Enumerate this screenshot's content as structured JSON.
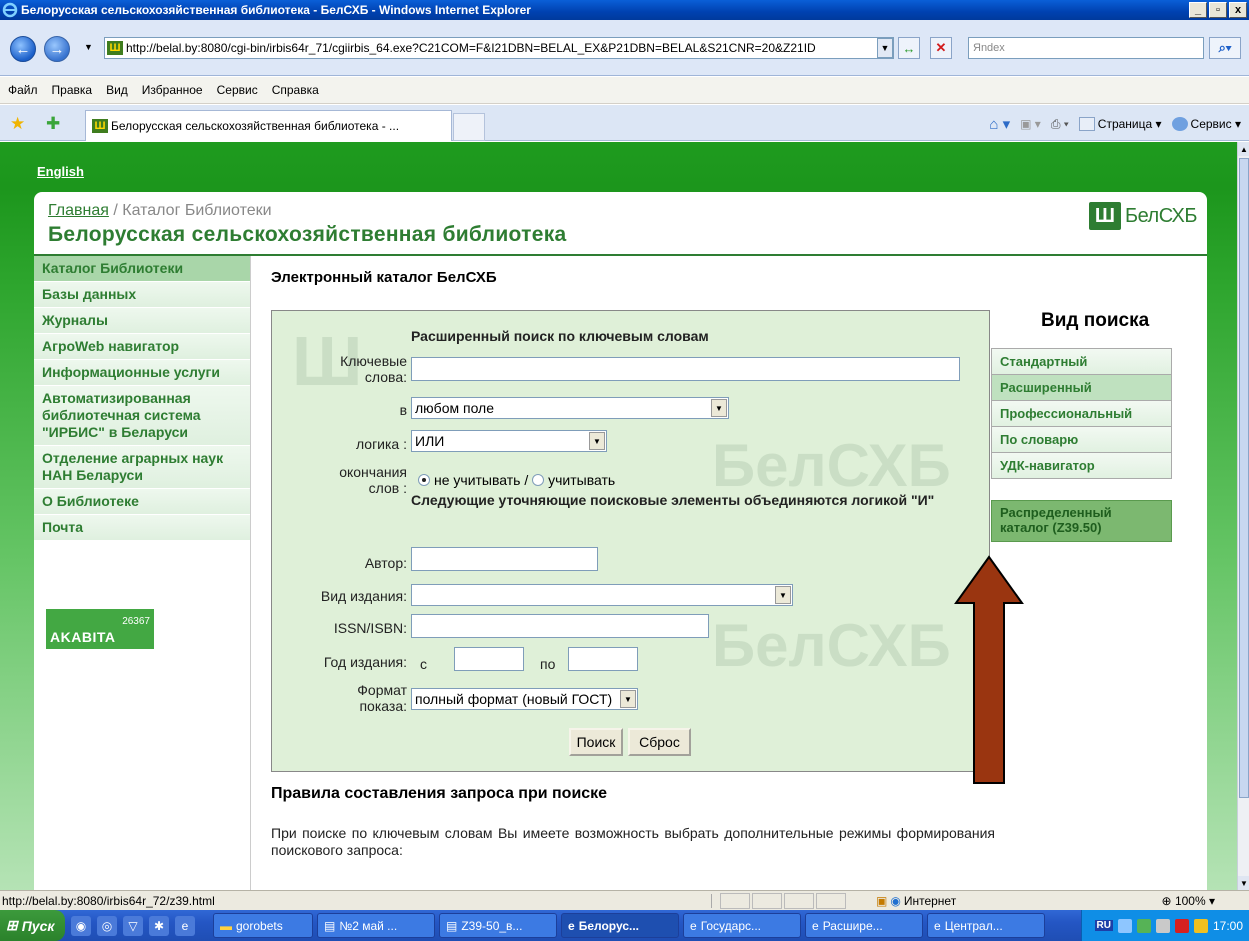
{
  "window": {
    "title": "Белорусская сельскохозяйственная библиотека - БелСХБ - Windows Internet Explorer"
  },
  "browser": {
    "url": "http://belal.by:8080/cgi-bin/irbis64r_71/cgiirbis_64.exe?C21COM=F&I21DBN=BELAL_EX&P21DBN=BELAL&S21CNR=20&Z21ID",
    "search_placeholder": "Яndex",
    "menu": [
      "Файл",
      "Правка",
      "Вид",
      "Избранное",
      "Сервис",
      "Справка"
    ],
    "tab_title": "Белорусская сельскохозяйственная библиотека - ...",
    "commands": {
      "page": "Страница",
      "tools": "Сервис"
    }
  },
  "page": {
    "english_link": "English",
    "breadcrumb_home": "Главная",
    "breadcrumb_sep": " / ",
    "breadcrumb_current": "Каталог Библиотеки",
    "site_title": "Белорусская сельскохозяйственная библиотека",
    "logo_text": "БелСХБ",
    "sidebar": [
      {
        "label": "Каталог Библиотеки"
      },
      {
        "label": "Базы данных"
      },
      {
        "label": "Журналы"
      },
      {
        "label": "АгроWeb навигатор"
      },
      {
        "label": "Информационные услуги"
      },
      {
        "label": "Автоматизированная библиотечная система \"ИРБИС\" в Беларуси"
      },
      {
        "label": "Отделение аграрных наук НАН Беларуси"
      },
      {
        "label": "О Библиотеке"
      },
      {
        "label": "Почта"
      }
    ],
    "counter": {
      "number": "26367",
      "brand": "AKABITA"
    },
    "catalog_heading": "Электронный каталог БелСХБ",
    "form": {
      "title": "Расширенный поиск по ключевым словам",
      "keywords_label": "Ключевые слова:",
      "keywords_value": "",
      "in_label": "в",
      "field_value": "любом поле",
      "logic_label": "логика :",
      "logic_value": "ИЛИ",
      "endings_label": "окончания слов :",
      "endings_opt1": "не учитывать /",
      "endings_opt2": "учитывать",
      "and_note": "Следующие уточняющие поисковые элементы объединяются логикой \"И\"",
      "author_label": "Автор:",
      "type_label": "Вид издания:",
      "type_value": "",
      "isbn_label": "ISSN/ISBN:",
      "year_label": "Год издания:",
      "year_from_label": "с",
      "year_to_label": "по",
      "format_label": "Формат показа:",
      "format_value": "полный формат (новый ГОСТ)",
      "search_button": "Поиск",
      "reset_button": "Сброс"
    },
    "search_type": {
      "title": "Вид поиска",
      "items": [
        {
          "label": "Стандартный",
          "active": false
        },
        {
          "label": "Расширенный",
          "active": true
        },
        {
          "label": "Профессиональный",
          "active": false
        },
        {
          "label": "По словарю",
          "active": false
        },
        {
          "label": "УДК-навигатор",
          "active": false
        }
      ],
      "distributed": "Распределенный каталог (Z39.50)"
    },
    "rules_heading": "Правила составления запроса при поиске",
    "rules_text": "При поиске по ключевым словам Вы имеете возможность выбрать дополнительные режимы формирования поискового запроса:"
  },
  "status": {
    "url": "http://belal.by:8080/irbis64r_72/z39.html",
    "zone": "Интернет",
    "zoom": "100%"
  },
  "taskbar": {
    "start": "Пуск",
    "tasks": [
      {
        "label": "gorobets",
        "active": false
      },
      {
        "label": "№2 май ...",
        "active": false
      },
      {
        "label": "Z39-50_в...",
        "active": false
      },
      {
        "label": "Белорус...",
        "active": true
      },
      {
        "label": "Государс...",
        "active": false
      },
      {
        "label": "Расшире...",
        "active": false
      },
      {
        "label": "Централ...",
        "active": false
      }
    ],
    "lang": "RU",
    "clock": "17:00"
  },
  "colors": {
    "brand_green": "#2e7d32",
    "panel_bg": "#dff0d8",
    "arrow": "#9a3510"
  }
}
